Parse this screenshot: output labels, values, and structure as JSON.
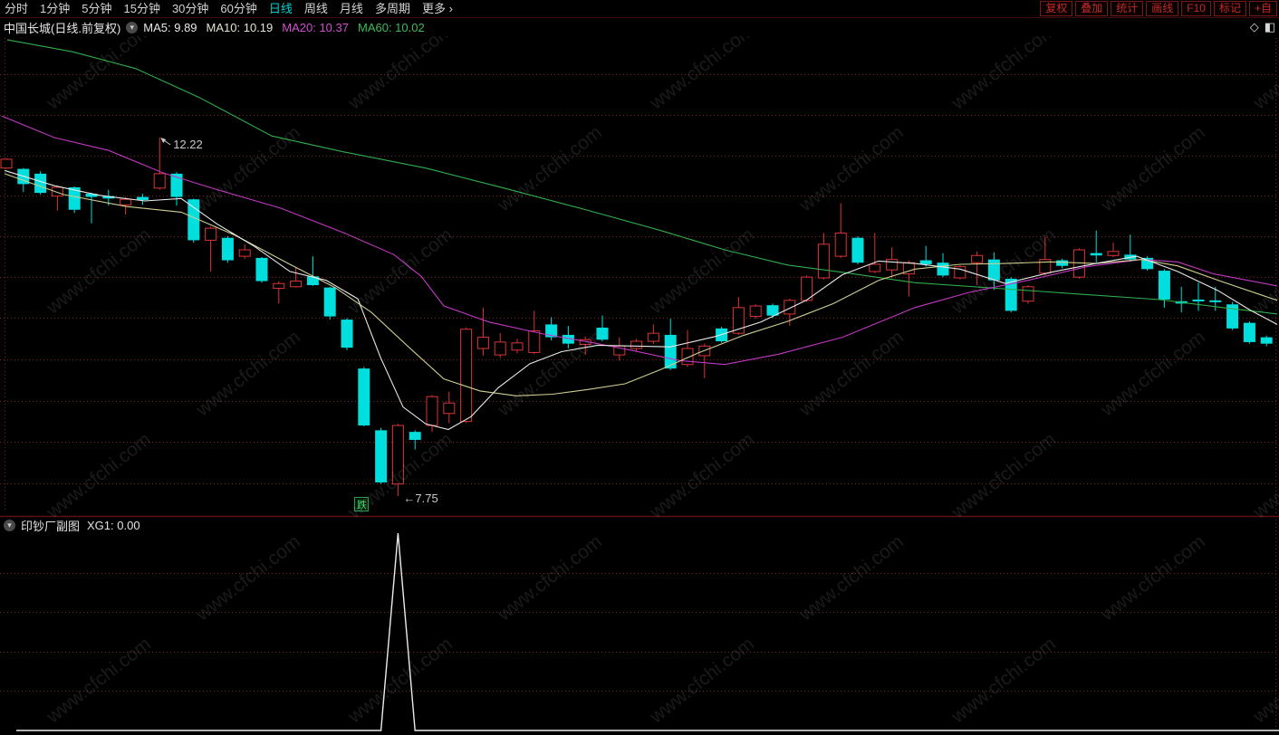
{
  "toolbar": {
    "periods": [
      {
        "name": "tab-time-share",
        "label": "分时",
        "active": false
      },
      {
        "name": "tab-1min",
        "label": "1分钟",
        "active": false
      },
      {
        "name": "tab-5min",
        "label": "5分钟",
        "active": false
      },
      {
        "name": "tab-15min",
        "label": "15分钟",
        "active": false
      },
      {
        "name": "tab-30min",
        "label": "30分钟",
        "active": false
      },
      {
        "name": "tab-60min",
        "label": "60分钟",
        "active": false
      },
      {
        "name": "tab-daily",
        "label": "日线",
        "active": true
      },
      {
        "name": "tab-weekly",
        "label": "周线",
        "active": false
      },
      {
        "name": "tab-monthly",
        "label": "月线",
        "active": false
      },
      {
        "name": "tab-multi-period",
        "label": "多周期",
        "active": false
      },
      {
        "name": "tab-more",
        "label": "更多 ›",
        "active": false
      }
    ],
    "right_buttons": [
      {
        "name": "btn-adjust",
        "label": "复权"
      },
      {
        "name": "btn-overlay",
        "label": "叠加"
      },
      {
        "name": "btn-stats",
        "label": "统计"
      },
      {
        "name": "btn-draw",
        "label": "画线"
      },
      {
        "name": "btn-f10",
        "label": "F10"
      },
      {
        "name": "btn-mark",
        "label": "标记"
      },
      {
        "name": "btn-add-custom",
        "label": "+自"
      }
    ]
  },
  "title_bar": {
    "stock_label": "中国长城(日线.前复权)",
    "ma_items": [
      {
        "label": "MA5: 9.89",
        "color": "#e8e8e8"
      },
      {
        "label": "MA10: 10.19",
        "color": "#e3e3cf"
      },
      {
        "label": "MA20: 10.37",
        "color": "#cf4fcf"
      },
      {
        "label": "MA60: 10.02",
        "color": "#3dbb58"
      }
    ],
    "diamond_icon": "◇",
    "panel_icon": "◧"
  },
  "subchart_header": {
    "title": "印钞厂副图",
    "value_label": "XG1: 0.00"
  },
  "annotations": {
    "high_label": "12.22",
    "low_label": "←7.75",
    "fall_badge": "跌"
  },
  "watermark_text": "www.cfchi.com",
  "colors": {
    "up": "#dd3434",
    "down": "#00dede",
    "grid": "#7e2222",
    "separator": "#5f1111",
    "annotation": "#c8c8c8",
    "badge_green": "#39e060",
    "indicator_line": "#ececec",
    "active_tab": "#00d2d2"
  },
  "chart_data": {
    "type": "candlestick+indicator",
    "stock": "中国长城",
    "period": "日线",
    "adjust": "前复权",
    "legend": {
      "MA5": 9.89,
      "MA10": 10.19,
      "MA20": 10.37,
      "MA60": 10.02
    },
    "price_annotations": {
      "high": 12.22,
      "low": 7.75
    },
    "grid": "horizontal-dotted",
    "candles": [
      [
        "u",
        11.84,
        11.96,
        11.83,
        11.95
      ],
      [
        "d",
        11.83,
        11.84,
        11.54,
        11.64
      ],
      [
        "d",
        11.77,
        11.8,
        11.51,
        11.53
      ],
      [
        "u",
        11.49,
        11.62,
        11.31,
        11.6
      ],
      [
        "d",
        11.6,
        11.61,
        11.28,
        11.32
      ],
      [
        "d",
        11.52,
        11.53,
        11.15,
        11.48
      ],
      [
        "d",
        11.49,
        11.57,
        11.37,
        11.46
      ],
      [
        "u",
        11.38,
        11.48,
        11.26,
        11.45
      ],
      [
        "d",
        11.48,
        11.52,
        11.38,
        11.44
      ],
      [
        "u",
        11.59,
        12.22,
        11.57,
        11.77
      ],
      [
        "d",
        11.77,
        11.79,
        11.37,
        11.48
      ],
      [
        "d",
        11.45,
        11.46,
        10.91,
        10.94
      ],
      [
        "u",
        10.94,
        11.11,
        10.55,
        11.09
      ],
      [
        "d",
        10.97,
        10.99,
        10.66,
        10.69
      ],
      [
        "u",
        10.74,
        10.89,
        10.71,
        10.82
      ],
      [
        "d",
        10.72,
        10.73,
        10.41,
        10.43
      ],
      [
        "u",
        10.34,
        10.43,
        10.15,
        10.4
      ],
      [
        "u",
        10.36,
        10.61,
        10.35,
        10.43
      ],
      [
        "d",
        10.49,
        10.74,
        10.37,
        10.38
      ],
      [
        "d",
        10.35,
        10.36,
        9.95,
        9.99
      ],
      [
        "d",
        9.95,
        9.97,
        9.57,
        9.6
      ],
      [
        "d",
        9.34,
        9.36,
        8.62,
        8.63
      ],
      [
        "d",
        8.57,
        8.6,
        7.9,
        7.92
      ],
      [
        "u",
        7.9,
        8.65,
        7.75,
        8.63
      ],
      [
        "d",
        8.55,
        8.57,
        8.33,
        8.45
      ],
      [
        "u",
        8.63,
        9.01,
        8.55,
        8.99
      ],
      [
        "u",
        8.78,
        9.05,
        8.66,
        8.91
      ],
      [
        "u",
        8.68,
        9.85,
        8.66,
        9.83
      ],
      [
        "u",
        9.59,
        10.1,
        9.5,
        9.73
      ],
      [
        "u",
        9.51,
        9.78,
        9.47,
        9.67
      ],
      [
        "u",
        9.57,
        9.71,
        9.53,
        9.66
      ],
      [
        "u",
        9.54,
        10.06,
        9.52,
        9.81
      ],
      [
        "d",
        9.89,
        9.98,
        9.69,
        9.73
      ],
      [
        "d",
        9.76,
        9.87,
        9.59,
        9.65
      ],
      [
        "u",
        9.64,
        9.74,
        9.51,
        9.7
      ],
      [
        "d",
        9.85,
        10.0,
        9.68,
        9.7
      ],
      [
        "u",
        9.51,
        9.73,
        9.44,
        9.62
      ],
      [
        "u",
        9.59,
        9.71,
        9.56,
        9.68
      ],
      [
        "u",
        9.68,
        9.89,
        9.65,
        9.78
      ],
      [
        "d",
        9.76,
        9.96,
        9.32,
        9.34
      ],
      [
        "u",
        9.39,
        9.82,
        9.36,
        9.59
      ],
      [
        "u",
        9.5,
        9.65,
        9.22,
        9.62
      ],
      [
        "d",
        9.84,
        9.86,
        9.66,
        9.68
      ],
      [
        "u",
        9.78,
        10.23,
        9.76,
        10.1
      ],
      [
        "u",
        9.99,
        10.14,
        9.96,
        10.12
      ],
      [
        "d",
        10.13,
        10.15,
        9.97,
        10.0
      ],
      [
        "u",
        10.02,
        10.21,
        9.87,
        10.19
      ],
      [
        "u",
        10.19,
        10.5,
        10.17,
        10.48
      ],
      [
        "u",
        10.47,
        11.03,
        10.45,
        10.89
      ],
      [
        "u",
        10.74,
        11.4,
        10.72,
        11.03
      ],
      [
        "d",
        10.97,
        10.99,
        10.64,
        10.66
      ],
      [
        "u",
        10.55,
        11.03,
        10.53,
        10.64
      ],
      [
        "u",
        10.57,
        10.85,
        10.47,
        10.7
      ],
      [
        "u",
        10.52,
        10.69,
        10.24,
        10.66
      ],
      [
        "d",
        10.69,
        10.87,
        10.61,
        10.64
      ],
      [
        "d",
        10.66,
        10.78,
        10.48,
        10.5
      ],
      [
        "u",
        10.47,
        10.63,
        10.45,
        10.61
      ],
      [
        "u",
        10.66,
        10.8,
        10.38,
        10.75
      ],
      [
        "d",
        10.7,
        10.79,
        10.32,
        10.44
      ],
      [
        "d",
        10.46,
        10.48,
        10.04,
        10.06
      ],
      [
        "u",
        10.18,
        10.38,
        10.15,
        10.36
      ],
      [
        "u",
        10.53,
        10.98,
        10.5,
        10.7
      ],
      [
        "d",
        10.69,
        10.71,
        10.59,
        10.62
      ],
      [
        "u",
        10.48,
        10.84,
        10.46,
        10.82
      ],
      [
        "d",
        10.78,
        11.06,
        10.66,
        10.75
      ],
      [
        "u",
        10.75,
        10.91,
        10.73,
        10.8
      ],
      [
        "d",
        10.76,
        11.01,
        10.67,
        10.7
      ],
      [
        "d",
        10.72,
        10.74,
        10.56,
        10.58
      ],
      [
        "d",
        10.56,
        10.58,
        10.1,
        10.2
      ],
      [
        "d",
        10.18,
        10.36,
        10.04,
        10.15
      ],
      [
        "d",
        10.2,
        10.41,
        10.06,
        10.18
      ],
      [
        "d",
        10.19,
        10.36,
        10.06,
        10.17
      ],
      [
        "d",
        10.14,
        10.17,
        9.82,
        9.84
      ],
      [
        "d",
        9.91,
        9.93,
        9.65,
        9.67
      ],
      [
        "d",
        9.73,
        9.75,
        9.62,
        9.65
      ]
    ],
    "ma_lines": [
      {
        "name": "MA60",
        "color": "#2fae4a",
        "points": [
          [
            8,
            13.44
          ],
          [
            80,
            13.29
          ],
          [
            150,
            13.08
          ],
          [
            220,
            12.72
          ],
          [
            300,
            12.24
          ],
          [
            380,
            12.04
          ],
          [
            470,
            11.84
          ],
          [
            560,
            11.58
          ],
          [
            650,
            11.31
          ],
          [
            730,
            11.06
          ],
          [
            800,
            10.82
          ],
          [
            870,
            10.63
          ],
          [
            930,
            10.54
          ],
          [
            1010,
            10.41
          ],
          [
            1100,
            10.34
          ],
          [
            1190,
            10.27
          ],
          [
            1280,
            10.2
          ],
          [
            1350,
            10.1
          ],
          [
            1410,
            10.02
          ]
        ]
      },
      {
        "name": "MA20",
        "color": "#c238c2",
        "points": [
          [
            2,
            12.49
          ],
          [
            60,
            12.22
          ],
          [
            120,
            12.06
          ],
          [
            180,
            11.78
          ],
          [
            240,
            11.57
          ],
          [
            310,
            11.34
          ],
          [
            380,
            11.03
          ],
          [
            435,
            10.76
          ],
          [
            465,
            10.49
          ],
          [
            490,
            10.12
          ],
          [
            540,
            9.92
          ],
          [
            600,
            9.77
          ],
          [
            660,
            9.65
          ],
          [
            700,
            9.56
          ],
          [
            750,
            9.44
          ],
          [
            800,
            9.39
          ],
          [
            860,
            9.52
          ],
          [
            930,
            9.73
          ],
          [
            1010,
            10.1
          ],
          [
            1070,
            10.29
          ],
          [
            1135,
            10.44
          ],
          [
            1200,
            10.61
          ],
          [
            1260,
            10.7
          ],
          [
            1300,
            10.67
          ],
          [
            1340,
            10.52
          ],
          [
            1410,
            10.37
          ]
        ]
      },
      {
        "name": "MA10",
        "color": "#cfcf8f",
        "points": [
          [
            5,
            11.77
          ],
          [
            70,
            11.51
          ],
          [
            140,
            11.36
          ],
          [
            200,
            11.29
          ],
          [
            260,
            11.0
          ],
          [
            320,
            10.64
          ],
          [
            370,
            10.35
          ],
          [
            410,
            10.04
          ],
          [
            450,
            9.62
          ],
          [
            490,
            9.21
          ],
          [
            530,
            9.06
          ],
          [
            570,
            9.0
          ],
          [
            610,
            9.02
          ],
          [
            650,
            9.08
          ],
          [
            690,
            9.15
          ],
          [
            730,
            9.33
          ],
          [
            770,
            9.53
          ],
          [
            820,
            9.75
          ],
          [
            870,
            9.93
          ],
          [
            920,
            10.15
          ],
          [
            970,
            10.44
          ],
          [
            1010,
            10.58
          ],
          [
            1060,
            10.64
          ],
          [
            1110,
            10.65
          ],
          [
            1160,
            10.67
          ],
          [
            1210,
            10.65
          ],
          [
            1260,
            10.7
          ],
          [
            1300,
            10.62
          ],
          [
            1350,
            10.42
          ],
          [
            1410,
            10.19
          ]
        ]
      },
      {
        "name": "MA5",
        "color": "#e9e9e9",
        "points": [
          [
            5,
            11.81
          ],
          [
            60,
            11.62
          ],
          [
            110,
            11.5
          ],
          [
            160,
            11.43
          ],
          [
            200,
            11.46
          ],
          [
            240,
            11.14
          ],
          [
            280,
            10.87
          ],
          [
            320,
            10.55
          ],
          [
            360,
            10.44
          ],
          [
            395,
            10.21
          ],
          [
            420,
            9.48
          ],
          [
            445,
            8.86
          ],
          [
            470,
            8.65
          ],
          [
            495,
            8.58
          ],
          [
            520,
            8.74
          ],
          [
            550,
            9.1
          ],
          [
            585,
            9.4
          ],
          [
            620,
            9.55
          ],
          [
            660,
            9.63
          ],
          [
            700,
            9.62
          ],
          [
            740,
            9.61
          ],
          [
            790,
            9.74
          ],
          [
            840,
            9.92
          ],
          [
            890,
            10.19
          ],
          [
            930,
            10.51
          ],
          [
            970,
            10.68
          ],
          [
            1010,
            10.65
          ],
          [
            1060,
            10.58
          ],
          [
            1110,
            10.4
          ],
          [
            1160,
            10.54
          ],
          [
            1210,
            10.65
          ],
          [
            1255,
            10.74
          ],
          [
            1300,
            10.55
          ],
          [
            1345,
            10.31
          ],
          [
            1380,
            10.07
          ],
          [
            1410,
            9.89
          ]
        ]
      }
    ],
    "indicator": {
      "name": "印钞厂副图",
      "label": "XG1",
      "current_value": 0.0,
      "signal_index": 23,
      "signal_value": 5,
      "ylim": [
        0,
        5
      ]
    }
  }
}
